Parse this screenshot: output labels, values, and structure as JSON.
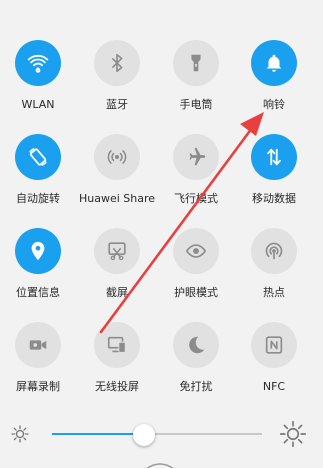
{
  "tiles": [
    {
      "label": "WLAN",
      "icon": "wifi-icon",
      "active": true
    },
    {
      "label": "蓝牙",
      "icon": "bluetooth-icon",
      "active": false
    },
    {
      "label": "手电筒",
      "icon": "flashlight-icon",
      "active": false
    },
    {
      "label": "响铃",
      "icon": "bell-icon",
      "active": true
    },
    {
      "label": "自动旋转",
      "icon": "rotate-icon",
      "active": true
    },
    {
      "label": "Huawei Share",
      "icon": "huawei-share-icon",
      "active": false
    },
    {
      "label": "飞行模式",
      "icon": "airplane-icon",
      "active": false
    },
    {
      "label": "移动数据",
      "icon": "mobile-data-icon",
      "active": true
    },
    {
      "label": "位置信息",
      "icon": "location-icon",
      "active": true
    },
    {
      "label": "截屏",
      "icon": "screenshot-icon",
      "active": false
    },
    {
      "label": "护眼模式",
      "icon": "eye-icon",
      "active": false
    },
    {
      "label": "热点",
      "icon": "hotspot-icon",
      "active": false
    },
    {
      "label": "屏幕录制",
      "icon": "screen-record-icon",
      "active": false
    },
    {
      "label": "无线投屏",
      "icon": "wireless-projection-icon",
      "active": false
    },
    {
      "label": "免打扰",
      "icon": "moon-icon",
      "active": false
    },
    {
      "label": "NFC",
      "icon": "nfc-icon",
      "active": false
    }
  ],
  "brightness": {
    "level": 0.44
  },
  "colors": {
    "accent": "#1aa0ee",
    "inactive_tile": "#e1e1e1",
    "inactive_icon": "#8c8c8c",
    "annotation_arrow": "#e8403e"
  }
}
